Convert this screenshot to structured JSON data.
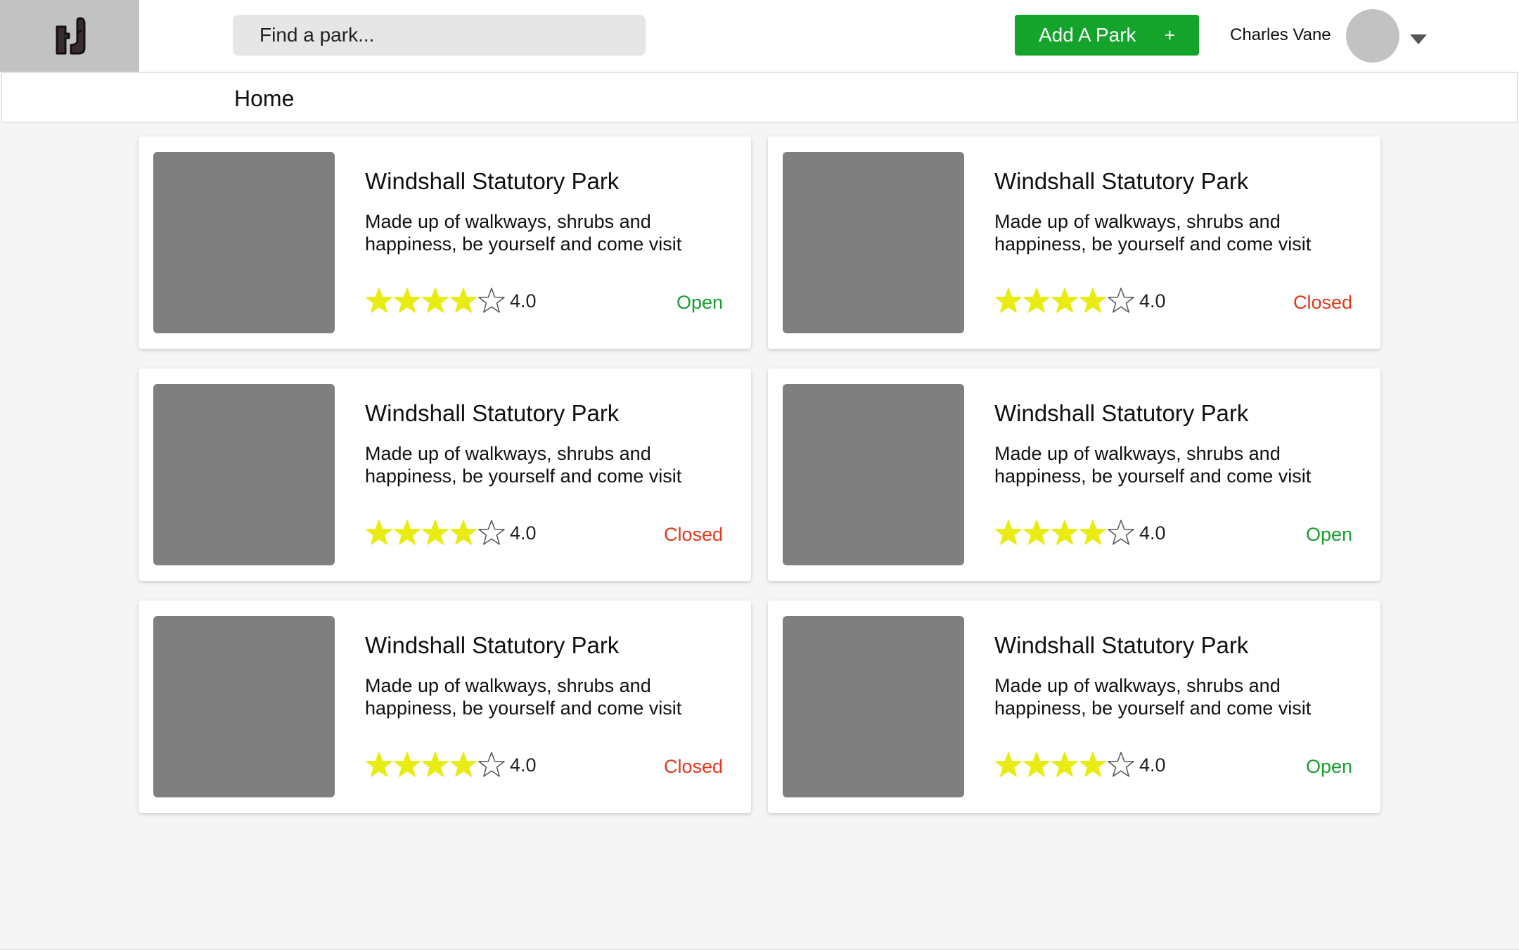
{
  "header": {
    "search_placeholder": "Find a park...",
    "add_button_label": "Add A Park",
    "add_button_plus": "+",
    "user_name": "Charles Vane"
  },
  "breadcrumb": {
    "current": "Home"
  },
  "colors": {
    "accent": "#14a32b",
    "open": "#1a9c2e",
    "closed": "#e0391c",
    "star": "#e9ec10"
  },
  "parks": [
    {
      "title": "Windshall Statutory Park",
      "description": "Made up of walkways, shrubs and happiness, be yourself and come visit",
      "rating": "4.0",
      "filled_stars": 4,
      "status": "Open"
    },
    {
      "title": "Windshall Statutory Park",
      "description": "Made up of walkways, shrubs and happiness, be yourself and come visit",
      "rating": "4.0",
      "filled_stars": 4,
      "status": "Closed"
    },
    {
      "title": "Windshall Statutory Park",
      "description": "Made up of walkways, shrubs and happiness, be yourself and come visit",
      "rating": "4.0",
      "filled_stars": 4,
      "status": "Closed"
    },
    {
      "title": "Windshall Statutory Park",
      "description": "Made up of walkways, shrubs and happiness, be yourself and come visit",
      "rating": "4.0",
      "filled_stars": 4,
      "status": "Open"
    },
    {
      "title": "Windshall Statutory Park",
      "description": "Made up of walkways, shrubs and happiness, be yourself and come visit",
      "rating": "4.0",
      "filled_stars": 4,
      "status": "Closed"
    },
    {
      "title": "Windshall Statutory Park",
      "description": "Made up of walkways, shrubs and happiness, be yourself and come visit",
      "rating": "4.0",
      "filled_stars": 4,
      "status": "Open"
    }
  ]
}
